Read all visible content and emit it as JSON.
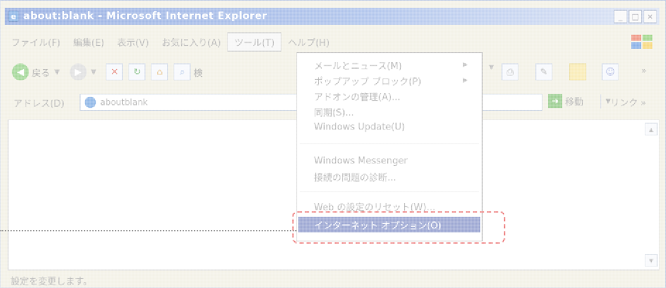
{
  "window": {
    "title": "about:blank - Microsoft Internet Explorer"
  },
  "window_controls": {
    "minimize": "_",
    "maximize": "□",
    "close": "×"
  },
  "menubar": {
    "items": [
      "ファイル(F)",
      "編集(E)",
      "表示(V)",
      "お気に入り(A)",
      "ツール(T)",
      "ヘルプ(H)"
    ]
  },
  "toolbar": {
    "back_label": "戻る",
    "search_label": "検",
    "more": "»"
  },
  "address": {
    "label": "アドレス(D)",
    "value": "aboutblank",
    "go_label": "移動",
    "links_label": "リンク »"
  },
  "tools_menu": {
    "items": [
      {
        "label": "メールとニュース(M)",
        "submenu": true
      },
      {
        "label": "ポップアップ ブロック(P)",
        "submenu": true
      },
      {
        "label": "アドオンの管理(A)...",
        "submenu": false
      },
      {
        "label": "同期(S)...",
        "submenu": false
      },
      {
        "label": "Windows Update(U)",
        "submenu": false
      },
      {
        "label": "Windows Messenger",
        "submenu": false
      },
      {
        "label": "接続の問題の診断...",
        "submenu": false
      },
      {
        "label": "Web の設定のリセット(W)...",
        "submenu": false
      }
    ],
    "highlighted": "インターネット オプション(O)"
  },
  "statusbar": {
    "text": "設定を変更します。"
  },
  "colors": {
    "titlebar": "#5a7fd0",
    "highlight": "#5e6fb7",
    "annotation": "#e23030"
  }
}
